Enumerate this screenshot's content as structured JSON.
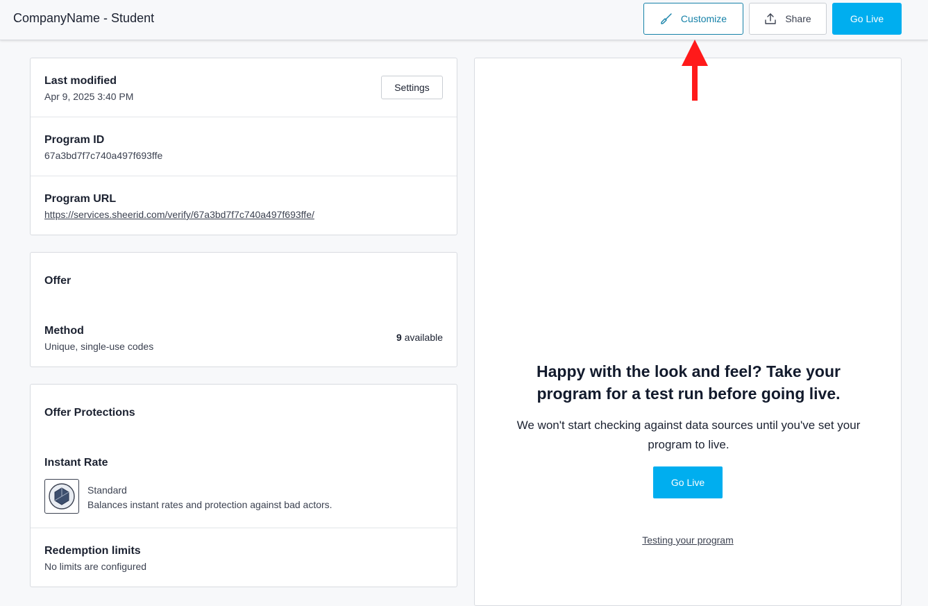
{
  "header": {
    "title": "CompanyName - Student",
    "customize_label": "Customize",
    "share_label": "Share",
    "go_live_label": "Go Live"
  },
  "details": {
    "last_modified_label": "Last modified",
    "last_modified_value": "Apr 9, 2025 3:40 PM",
    "settings_label": "Settings",
    "program_id_label": "Program ID",
    "program_id_value": "67a3bd7f7c740a497f693ffe",
    "program_url_label": "Program URL",
    "program_url_value": "https://services.sheerid.com/verify/67a3bd7f7c740a497f693ffe/"
  },
  "offer": {
    "title": "Offer",
    "method_label": "Method",
    "method_value": "Unique, single-use codes",
    "available_count": "9",
    "available_label": "available"
  },
  "protections": {
    "title": "Offer Protections",
    "instant_rate_label": "Instant Rate",
    "rate_name": "Standard",
    "rate_description": "Balances instant rates and protection against bad actors.",
    "redemption_label": "Redemption limits",
    "redemption_value": "No limits are configured"
  },
  "preview": {
    "heading": "Happy with the look and feel? Take your program for a test run before going live.",
    "body": "We won't start checking against data sources until you've set your program to live.",
    "go_live_label": "Go Live",
    "testing_link": "Testing your program"
  },
  "colors": {
    "accent": "#00aeef",
    "customize_border": "#1581a8",
    "annotation": "#ff1a1a"
  }
}
